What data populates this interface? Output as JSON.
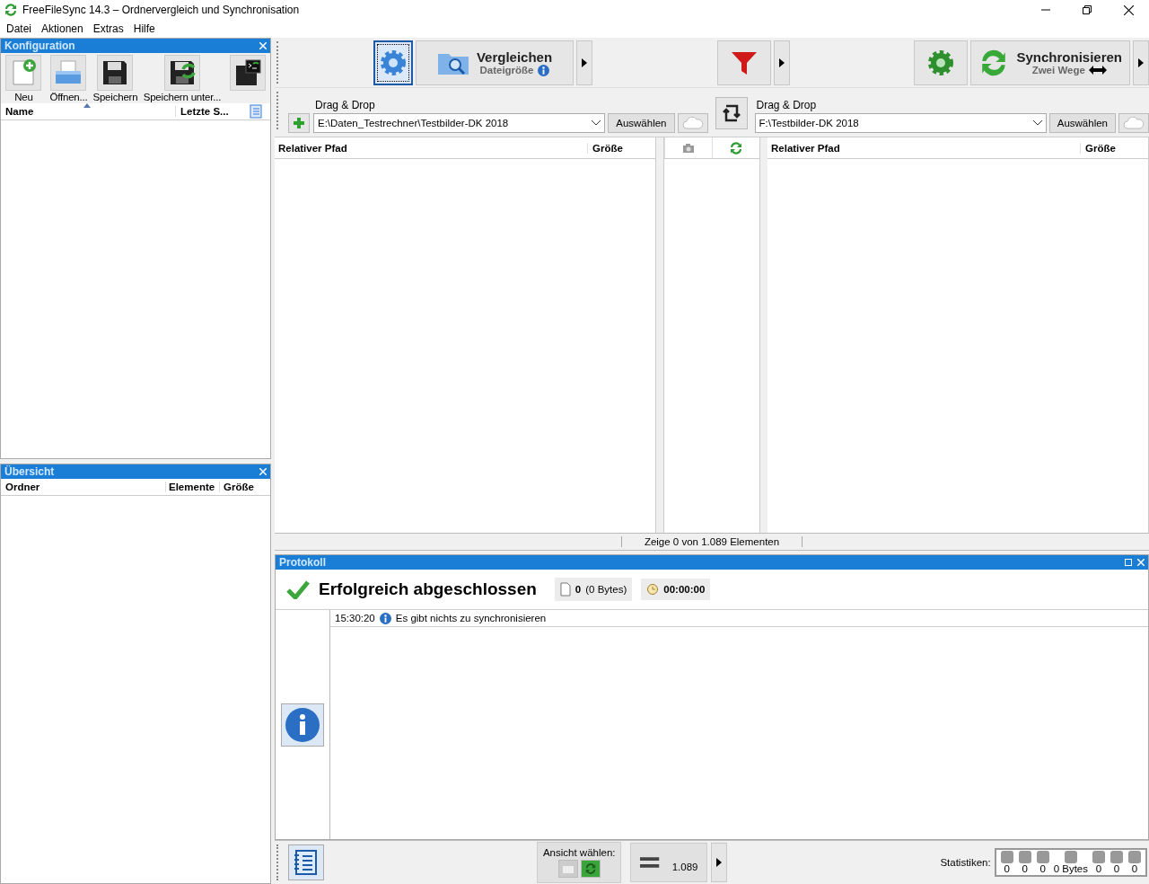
{
  "window": {
    "title": "FreeFileSync 14.3 – Ordnervergleich und Synchronisation"
  },
  "menu": [
    {
      "label": "Datei"
    },
    {
      "label": "Aktionen"
    },
    {
      "label": "Extras"
    },
    {
      "label": "Hilfe"
    }
  ],
  "config_panel": {
    "title": "Konfiguration",
    "buttons": [
      {
        "kind": "new",
        "label": "Neu"
      },
      {
        "kind": "open",
        "label": "Öffnen..."
      },
      {
        "kind": "save",
        "label": "Speichern"
      },
      {
        "kind": "saveas",
        "label": "Speichern unter..."
      }
    ],
    "columns": [
      "Name",
      "Letzte S..."
    ]
  },
  "overview_panel": {
    "title": "Übersicht",
    "columns": [
      "Ordner",
      "Elemente",
      "Größe"
    ]
  },
  "toolbar": {
    "compare": {
      "label": "Vergleichen",
      "sub": "Dateigröße"
    },
    "sync": {
      "label": "Synchronisieren",
      "sub": "Zwei Wege"
    }
  },
  "folders": [
    {
      "label": "Drag & Drop",
      "path": "E:\\Daten_Testrechner\\Testbilder-DK 2018",
      "button": "Auswählen"
    },
    {
      "label": "Drag & Drop",
      "path": "F:\\Testbilder-DK 2018",
      "button": "Auswählen"
    }
  ],
  "grid": {
    "left_columns": [
      "Relativer Pfad",
      "Größe"
    ],
    "right_columns": [
      "Relativer Pfad",
      "Größe"
    ]
  },
  "status": "Zeige 0 von 1.089 Elementen",
  "log": {
    "title": "Protokoll",
    "result": "Erfolgreich abgeschlossen",
    "count": "0",
    "bytes": "(0 Bytes)",
    "time": "00:00:00",
    "entries": [
      {
        "time": "15:30:20",
        "text": "Es gibt nichts zu synchronisieren"
      }
    ]
  },
  "bottom": {
    "view_label": "Ansicht wählen:",
    "count": "1.089",
    "stats_label": "Statistiken:",
    "stats": [
      "0",
      "0",
      "0",
      "0 Bytes",
      "0",
      "0",
      "0"
    ]
  }
}
